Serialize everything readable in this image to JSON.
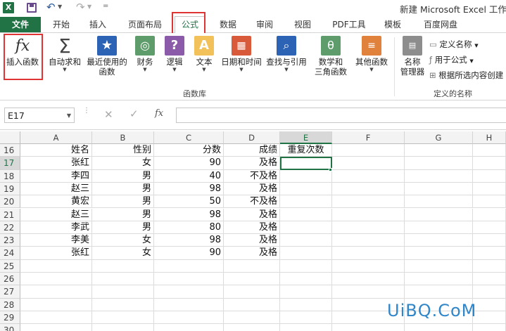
{
  "window": {
    "title": "新建 Microsoft Excel 工作表"
  },
  "tabs": [
    {
      "label": "文件"
    },
    {
      "label": "开始"
    },
    {
      "label": "插入"
    },
    {
      "label": "页面布局"
    },
    {
      "label": "公式"
    },
    {
      "label": "数据"
    },
    {
      "label": "审阅"
    },
    {
      "label": "视图"
    },
    {
      "label": "PDF工具"
    },
    {
      "label": "模板"
    },
    {
      "label": "百度网盘"
    }
  ],
  "ribbon": {
    "fx_glyph": "fx",
    "insert_function": "插入函数",
    "autosum": "自动求和",
    "recent_line1": "最近使用的",
    "recent_line2": "函数",
    "financial": "财务",
    "logical": "逻辑",
    "text": "文本",
    "datetime": "日期和时间",
    "lookup": "查找与引用",
    "math_line1": "数学和",
    "math_line2": "三角函数",
    "more": "其他函数",
    "name_mgr_line1": "名称",
    "name_mgr_line2": "管理器",
    "define_name": "定义名称",
    "use_in_formula": "用于公式",
    "create_from_selection": "根据所选内容创建",
    "group_library": "函数库",
    "group_names": "定义的名称"
  },
  "formula_bar": {
    "name_box": "E17",
    "fx": "fx",
    "value": ""
  },
  "columns": [
    "A",
    "B",
    "C",
    "D",
    "E",
    "F",
    "G",
    "H"
  ],
  "rows": [
    {
      "num": "16",
      "cells": [
        "姓名",
        "性别",
        "分数",
        "成绩",
        "重复次数"
      ]
    },
    {
      "num": "17",
      "cells": [
        "张红",
        "女",
        "90",
        "及格",
        ""
      ]
    },
    {
      "num": "18",
      "cells": [
        "李四",
        "男",
        "40",
        "不及格",
        ""
      ]
    },
    {
      "num": "19",
      "cells": [
        "赵三",
        "男",
        "98",
        "及格",
        ""
      ]
    },
    {
      "num": "20",
      "cells": [
        "黄宏",
        "男",
        "50",
        "不及格",
        ""
      ]
    },
    {
      "num": "21",
      "cells": [
        "赵三",
        "男",
        "98",
        "及格",
        ""
      ]
    },
    {
      "num": "22",
      "cells": [
        "李武",
        "男",
        "80",
        "及格",
        ""
      ]
    },
    {
      "num": "23",
      "cells": [
        "李美",
        "女",
        "98",
        "及格",
        ""
      ]
    },
    {
      "num": "24",
      "cells": [
        "张红",
        "女",
        "90",
        "及格",
        ""
      ]
    },
    {
      "num": "25",
      "cells": [
        "",
        "",
        "",
        "",
        ""
      ]
    },
    {
      "num": "26",
      "cells": [
        "",
        "",
        "",
        "",
        ""
      ]
    },
    {
      "num": "27",
      "cells": [
        "",
        "",
        "",
        "",
        ""
      ]
    },
    {
      "num": "28",
      "cells": [
        "",
        "",
        "",
        "",
        ""
      ]
    },
    {
      "num": "29",
      "cells": [
        "",
        "",
        "",
        "",
        ""
      ]
    },
    {
      "num": "30",
      "cells": [
        "",
        "",
        "",
        "",
        ""
      ]
    }
  ],
  "selected_cell": "E17",
  "watermark": "UiBQ.CoM",
  "colors": {
    "excel_green": "#217346",
    "highlight_red": "#e03333",
    "selection_green": "#217346"
  }
}
